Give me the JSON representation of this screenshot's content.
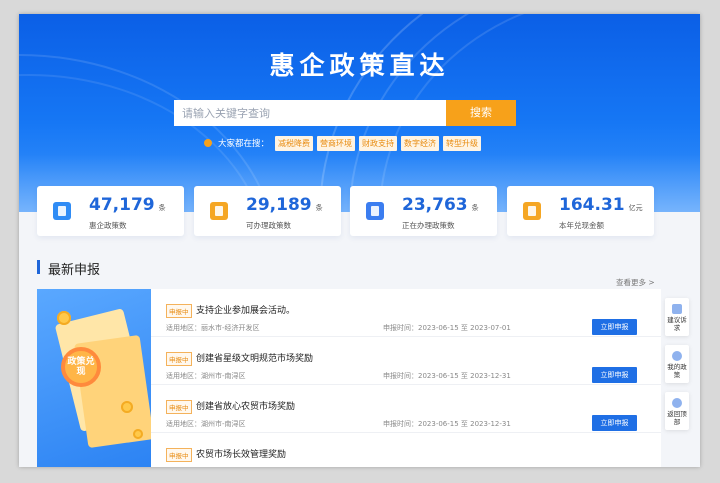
{
  "hero": {
    "title": "惠企政策直达",
    "search_placeholder": "请输入关键字查询",
    "search_button": "搜索",
    "hot_label": "大家都在搜：",
    "hot_tags": [
      "减税降费",
      "营商环境",
      "财政支持",
      "数字经济",
      "转型升级"
    ]
  },
  "stats": [
    {
      "value": "47,179",
      "unit": "条",
      "label": "惠企政策数",
      "color": "#2f8cf5"
    },
    {
      "value": "29,189",
      "unit": "条",
      "label": "可办理政策数",
      "color": "#f5a623"
    },
    {
      "value": "23,763",
      "unit": "条",
      "label": "正在办理政策数",
      "color": "#3b7df0"
    },
    {
      "value": "164.31",
      "unit": "亿元",
      "label": "本年兑现金额",
      "color": "#f5a623"
    }
  ],
  "section": {
    "title": "最新申报",
    "more": "查看更多 >"
  },
  "illustration": {
    "badge_text": "政策兑现"
  },
  "list": [
    {
      "tag": "申报中",
      "title": "支持企业参加展会活动。",
      "region": "适用地区：丽水市-经济开发区",
      "date": "申报时间：2023-06-15 至 2023-07-01",
      "button": "立即申报"
    },
    {
      "tag": "申报中",
      "title": "创建省星级文明规范市场奖励",
      "region": "适用地区：湖州市-南浔区",
      "date": "申报时间：2023-06-15 至 2023-12-31",
      "button": "立即申报"
    },
    {
      "tag": "申报中",
      "title": "创建省放心农贸市场奖励",
      "region": "适用地区：湖州市-南浔区",
      "date": "申报时间：2023-06-15 至 2023-12-31",
      "button": "立即申报"
    },
    {
      "tag": "申报中",
      "title": "农贸市场长效管理奖励",
      "region": "",
      "date": "",
      "button": ""
    }
  ],
  "float_bar": [
    {
      "icon": "feedback-icon",
      "label": "建议诉求"
    },
    {
      "icon": "user-icon",
      "label": "我的政策"
    },
    {
      "icon": "arrow-up-icon",
      "label": "返回顶部"
    }
  ]
}
